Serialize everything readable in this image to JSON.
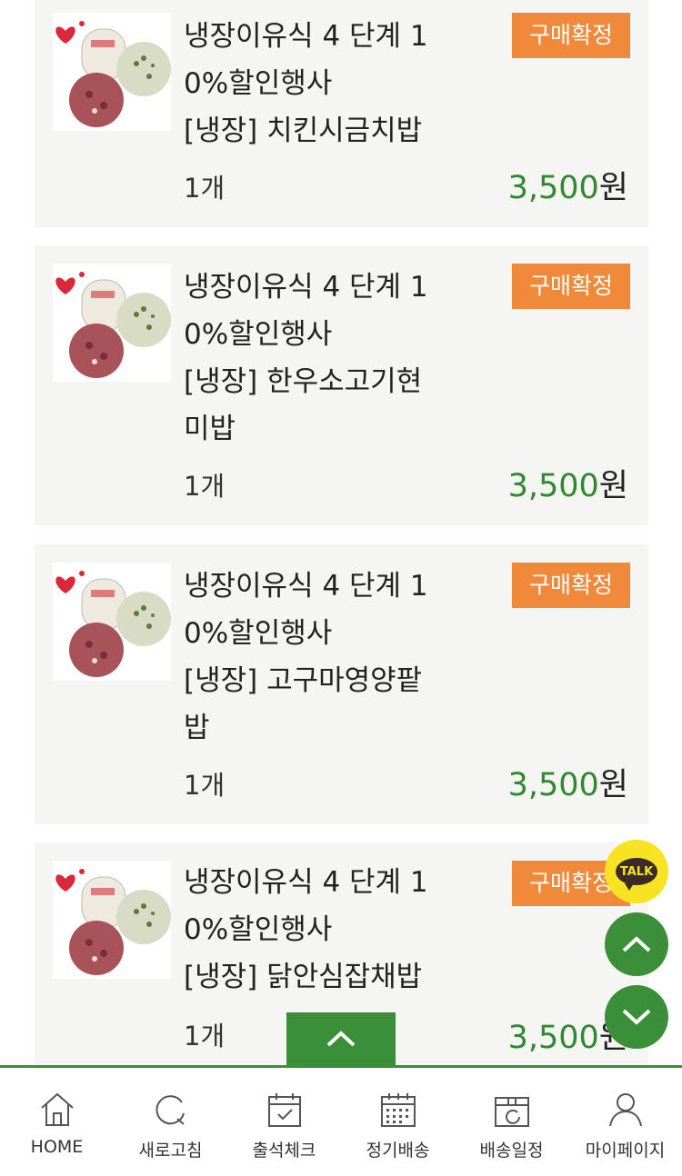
{
  "orders": [
    {
      "title_lines": [
        "냉장이유식 4 단계 1",
        "0%할인행사",
        "[냉장] 치킨시금치밥"
      ],
      "status": "구매확정",
      "quantity": "1개",
      "price": "3,500",
      "currency": "원"
    },
    {
      "title_lines": [
        "냉장이유식 4 단계 1",
        "0%할인행사",
        "[냉장] 한우소고기현",
        "미밥"
      ],
      "status": "구매확정",
      "quantity": "1개",
      "price": "3,500",
      "currency": "원"
    },
    {
      "title_lines": [
        "냉장이유식 4 단계 1",
        "0%할인행사",
        "[냉장] 고구마영양팥",
        "밥"
      ],
      "status": "구매확정",
      "quantity": "1개",
      "price": "3,500",
      "currency": "원"
    },
    {
      "title_lines": [
        "냉장이유식 4 단계 1",
        "0%할인행사",
        "[냉장] 닭안심잡채밥"
      ],
      "status": "구매확정",
      "quantity": "1개",
      "price": "3,500",
      "currency": "원"
    }
  ],
  "kakao": {
    "label": "TALK"
  },
  "bottom_nav": [
    {
      "label": "HOME",
      "icon": "home-icon"
    },
    {
      "label": "새로고침",
      "icon": "refresh-icon"
    },
    {
      "label": "출석체크",
      "icon": "calendar-check-icon"
    },
    {
      "label": "정기배송",
      "icon": "calendar-grid-icon"
    },
    {
      "label": "배송일정",
      "icon": "delivery-box-icon"
    },
    {
      "label": "마이페이지",
      "icon": "user-icon"
    }
  ],
  "colors": {
    "accent_green": "#3a8f38",
    "badge_orange": "#f0893a",
    "price_green": "#2f8a2f",
    "card_bg": "#f5f5f3"
  }
}
